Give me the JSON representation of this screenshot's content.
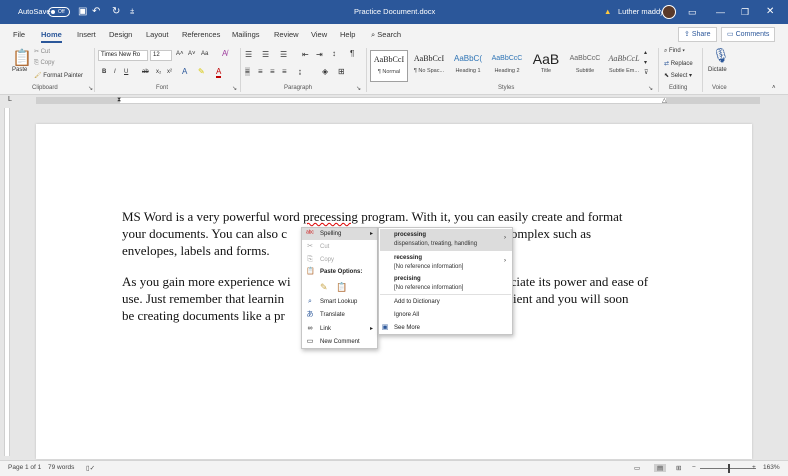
{
  "titlebar": {
    "autosave_label": "AutoSave",
    "autosave_state": "Off",
    "document_title": "Practice Document.docx",
    "user_name": "Luther maddy"
  },
  "tabs": [
    "File",
    "Home",
    "Insert",
    "Design",
    "Layout",
    "References",
    "Mailings",
    "Review",
    "View",
    "Help"
  ],
  "active_tab": "Home",
  "search_label": "Search",
  "share_label": "Share",
  "comments_label": "Comments",
  "ribbon": {
    "clipboard": {
      "paste": "Paste",
      "cut": "Cut",
      "copy": "Copy",
      "format_painter": "Format Painter",
      "group": "Clipboard"
    },
    "font": {
      "font_name": "Times New Ro",
      "font_size": "12",
      "change_case": "Aa",
      "bold": "B",
      "italic": "I",
      "underline": "U",
      "strike": "ab",
      "subscript": "x₂",
      "superscript": "x²",
      "group": "Font"
    },
    "paragraph": {
      "group": "Paragraph"
    },
    "styles": {
      "items": [
        {
          "preview": "AaBbCcI",
          "name": "¶ Normal"
        },
        {
          "preview": "AaBbCcI",
          "name": "¶ No Spac..."
        },
        {
          "preview": "AaBbC(",
          "name": "Heading 1"
        },
        {
          "preview": "AaBbCcC",
          "name": "Heading 2"
        },
        {
          "preview": "AaB",
          "name": "Title"
        },
        {
          "preview": "AaBbCcC",
          "name": "Subtitle"
        },
        {
          "preview": "AaBbCcL",
          "name": "Subtle Em..."
        }
      ],
      "group": "Styles"
    },
    "editing": {
      "find": "Find",
      "replace": "Replace",
      "select": "Select",
      "group": "Editing"
    },
    "voice": {
      "dictate": "Dictate",
      "group": "Voice"
    }
  },
  "document": {
    "para1_before": "MS Word is a very powerful word ",
    "para1_misspelled": "precessing",
    "para1_after": " program.  With it, you can easily create and format",
    "para1_line2a": "your documents.  You can also c",
    "para1_line2b": "ry complex such as",
    "para1_line3": "envelopes, labels and forms.",
    "para2_line1a": "As you gain more experience wi",
    "para2_line1b": "ciate its power and ease of",
    "para2_line2a": "use.  Just remember that learnin",
    "para2_line2b": "e patient and you will soon",
    "para2_line3": "be creating documents like a pr"
  },
  "context_menu": {
    "spelling": "Spelling",
    "cut": "Cut",
    "copy": "Copy",
    "paste_options": "Paste Options:",
    "smart_lookup": "Smart Lookup",
    "translate": "Translate",
    "link": "Link",
    "new_comment": "New Comment"
  },
  "spelling_submenu": {
    "suggestions": [
      {
        "word": "processing",
        "definition": "dispensation, treating, handling"
      },
      {
        "word": "recessing",
        "definition": "[No reference information]"
      },
      {
        "word": "precising",
        "definition": "[No reference information]"
      }
    ],
    "add_to_dictionary": "Add to Dictionary",
    "ignore_all": "Ignore All",
    "see_more": "See More"
  },
  "status": {
    "page": "Page 1 of 1",
    "words": "79 words",
    "zoom": "163%"
  },
  "colors": {
    "accent": "#2b579a",
    "misspell": "#dd0000"
  }
}
